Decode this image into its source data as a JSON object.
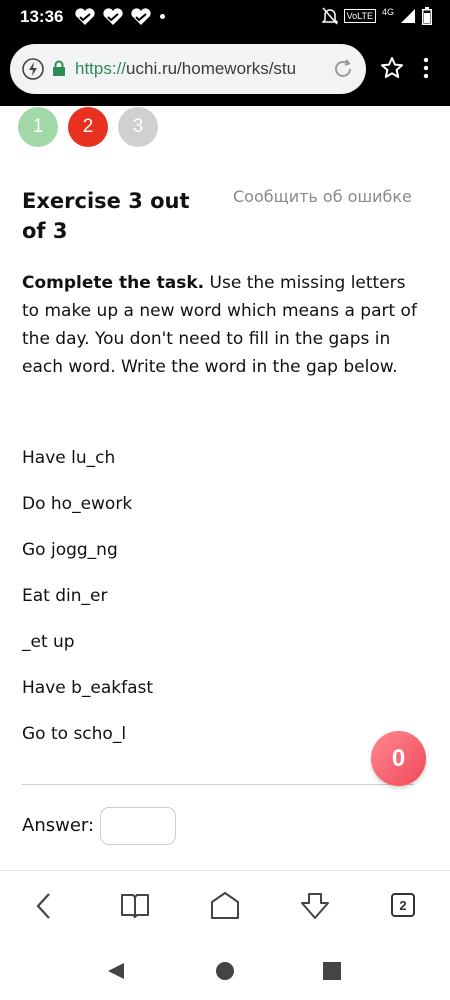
{
  "status_bar": {
    "time": "13:36",
    "volte": "VoLTE",
    "network": "4G"
  },
  "browser": {
    "url_scheme": "https://",
    "url_rest": "uchi.ru/homeworks/stu",
    "tab_count": "2"
  },
  "steps": [
    "1",
    "2",
    "3"
  ],
  "exercise": {
    "title": "Exercise 3 out of 3",
    "report_link": "Сообщить об ошибке",
    "task_bold": "Complete the task.",
    "task_text": " Use the missing letters to make up a new word which means a part of the day. You don't need to fill in the gaps in each word. Write the word in the gap below.",
    "lines": [
      "Have lu_ch",
      "Do ho_ework",
      "Go jogg_ng",
      "Eat din_er",
      "_et up",
      "Have b_eakfast",
      "Go to scho_l"
    ],
    "answer_label": "Answer:",
    "answer_value": ""
  },
  "score": "0",
  "colors": {
    "step_done": "#a3d9a8",
    "step_current": "#e8321f",
    "step_todo": "#d0d0d0",
    "url_scheme": "#2e8b57",
    "score_bubble": "#f0485a"
  }
}
